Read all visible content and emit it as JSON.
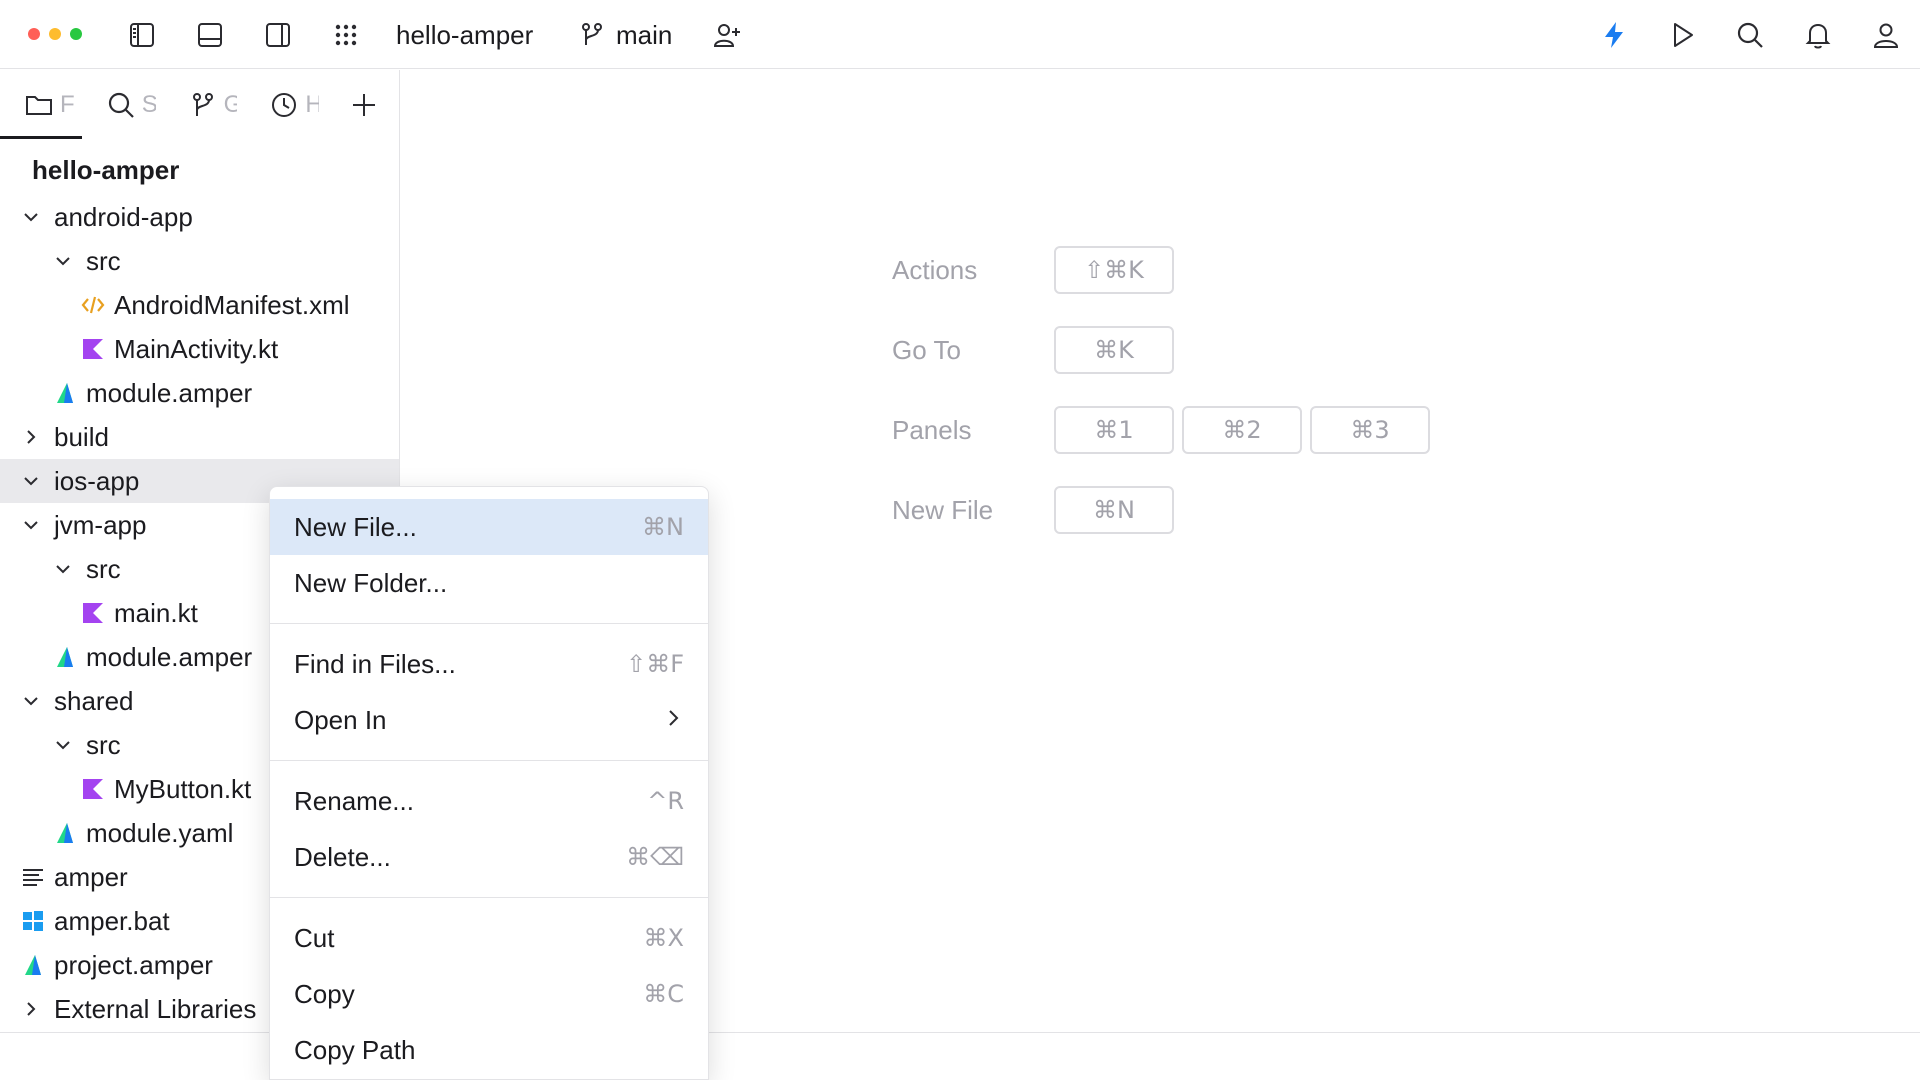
{
  "titlebar": {
    "project": "hello-amper",
    "branch": "main"
  },
  "panel_tabs": [
    {
      "label": "Files"
    },
    {
      "label": "Search"
    },
    {
      "label": "Git"
    },
    {
      "label": "History"
    }
  ],
  "tree": {
    "root": "hello-amper",
    "items": [
      {
        "label": "android-app"
      },
      {
        "label": "src"
      },
      {
        "label": "AndroidManifest.xml"
      },
      {
        "label": "MainActivity.kt"
      },
      {
        "label": "module.amper"
      },
      {
        "label": "build"
      },
      {
        "label": "ios-app"
      },
      {
        "label": "jvm-app"
      },
      {
        "label": "src"
      },
      {
        "label": "main.kt"
      },
      {
        "label": "module.amper"
      },
      {
        "label": "shared"
      },
      {
        "label": "src"
      },
      {
        "label": "MyButton.kt"
      },
      {
        "label": "module.yaml"
      },
      {
        "label": "amper"
      },
      {
        "label": "amper.bat"
      },
      {
        "label": "project.amper"
      },
      {
        "label": "External Libraries"
      }
    ]
  },
  "hints": {
    "actions": {
      "label": "Actions",
      "key": "⇧⌘K"
    },
    "goto": {
      "label": "Go To",
      "key": "⌘K"
    },
    "panels": {
      "label": "Panels",
      "keys": [
        "⌘1",
        "⌘2",
        "⌘3"
      ]
    },
    "newfile": {
      "label": "New File",
      "key": "⌘N"
    }
  },
  "context_menu": {
    "items": [
      {
        "label": "New File...",
        "shortcut": "⌘N"
      },
      {
        "label": "New Folder...",
        "shortcut": ""
      },
      {
        "label": "Find in Files...",
        "shortcut": "⇧⌘F"
      },
      {
        "label": "Open In",
        "shortcut": ""
      },
      {
        "label": "Rename...",
        "shortcut": "^R"
      },
      {
        "label": "Delete...",
        "shortcut": "⌘⌫"
      },
      {
        "label": "Cut",
        "shortcut": "⌘X"
      },
      {
        "label": "Copy",
        "shortcut": "⌘C"
      },
      {
        "label": "Copy Path",
        "shortcut": ""
      }
    ]
  },
  "colors": {
    "accent": "#1a7cf0",
    "kotlin": "#a443f0",
    "xml": "#e8a020",
    "selection": "#dce8f8"
  }
}
